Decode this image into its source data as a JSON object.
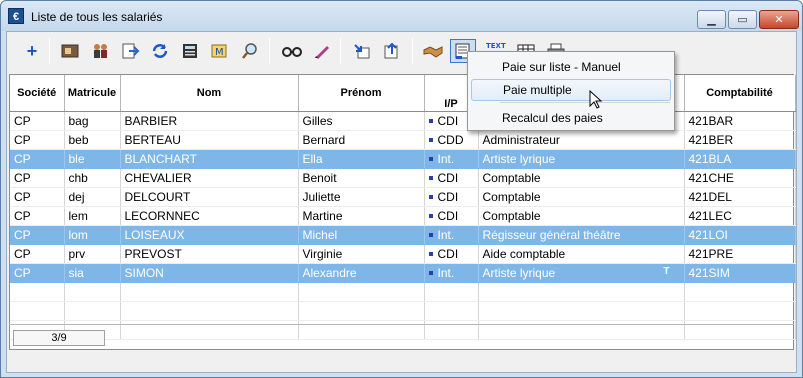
{
  "window": {
    "title": "Liste de tous les salariés",
    "app_icon": "€"
  },
  "toolbar": {
    "icons": [
      "add-icon",
      "card-icon",
      "people-icon",
      "export-icon",
      "refresh-icon",
      "calculator-icon",
      "map-icon",
      "search-icon",
      "glasses-icon",
      "pen-icon",
      "import-icon",
      "upload-icon",
      "handshake-icon",
      "pay-multi-icon",
      "text-icon",
      "grid-icon",
      "print-icon"
    ]
  },
  "table": {
    "headers": {
      "societe": "Société",
      "matricule": "Matricule",
      "nom": "Nom",
      "prenom": "Prénom",
      "ip": "I/P",
      "comptabilite": "Comptabilité"
    },
    "rows": [
      {
        "societe": "CP",
        "matricule": "bag",
        "nom": "BARBIER",
        "prenom": "Gilles",
        "contrat": "CDI",
        "emploi": "",
        "flag": "",
        "compta": "421BAR",
        "selected": false
      },
      {
        "societe": "CP",
        "matricule": "beb",
        "nom": "BERTEAU",
        "prenom": "Bernard",
        "contrat": "CDD",
        "emploi": "Administrateur",
        "flag": "",
        "compta": "421BER",
        "selected": false
      },
      {
        "societe": "CP",
        "matricule": "ble",
        "nom": "BLANCHART",
        "prenom": "Ella",
        "contrat": "Int.",
        "emploi": "Artiste lyrique",
        "flag": "",
        "compta": "421BLA",
        "selected": true
      },
      {
        "societe": "CP",
        "matricule": "chb",
        "nom": "CHEVALIER",
        "prenom": "Benoit",
        "contrat": "CDI",
        "emploi": "Comptable",
        "flag": "",
        "compta": "421CHE",
        "selected": false
      },
      {
        "societe": "CP",
        "matricule": "dej",
        "nom": "DELCOURT",
        "prenom": "Juliette",
        "contrat": "CDI",
        "emploi": "Comptable",
        "flag": "",
        "compta": "421DEL",
        "selected": false
      },
      {
        "societe": "CP",
        "matricule": "lem",
        "nom": "LECORNNEC",
        "prenom": "Martine",
        "contrat": "CDI",
        "emploi": "Comptable",
        "flag": "",
        "compta": "421LEC",
        "selected": false
      },
      {
        "societe": "CP",
        "matricule": "lom",
        "nom": "LOISEAUX",
        "prenom": "Michel",
        "contrat": "Int.",
        "emploi": "Régisseur général théâtre",
        "flag": "",
        "compta": "421LOI",
        "selected": true
      },
      {
        "societe": "CP",
        "matricule": "prv",
        "nom": "PREVOST",
        "prenom": "Virginie",
        "contrat": "CDI",
        "emploi": "Aide comptable",
        "flag": "",
        "compta": "421PRE",
        "selected": false
      },
      {
        "societe": "CP",
        "matricule": "sia",
        "nom": "SIMON",
        "prenom": "Alexandre",
        "contrat": "Int.",
        "emploi": "Artiste lyrique",
        "flag": "T",
        "compta": "421SIM",
        "selected": true
      }
    ]
  },
  "status": {
    "counter": "3/9"
  },
  "context_menu": {
    "items": [
      "Paie sur liste - Manuel",
      "Paie multiple",
      "Recalcul des paies"
    ],
    "hovered": "Paie multiple"
  }
}
